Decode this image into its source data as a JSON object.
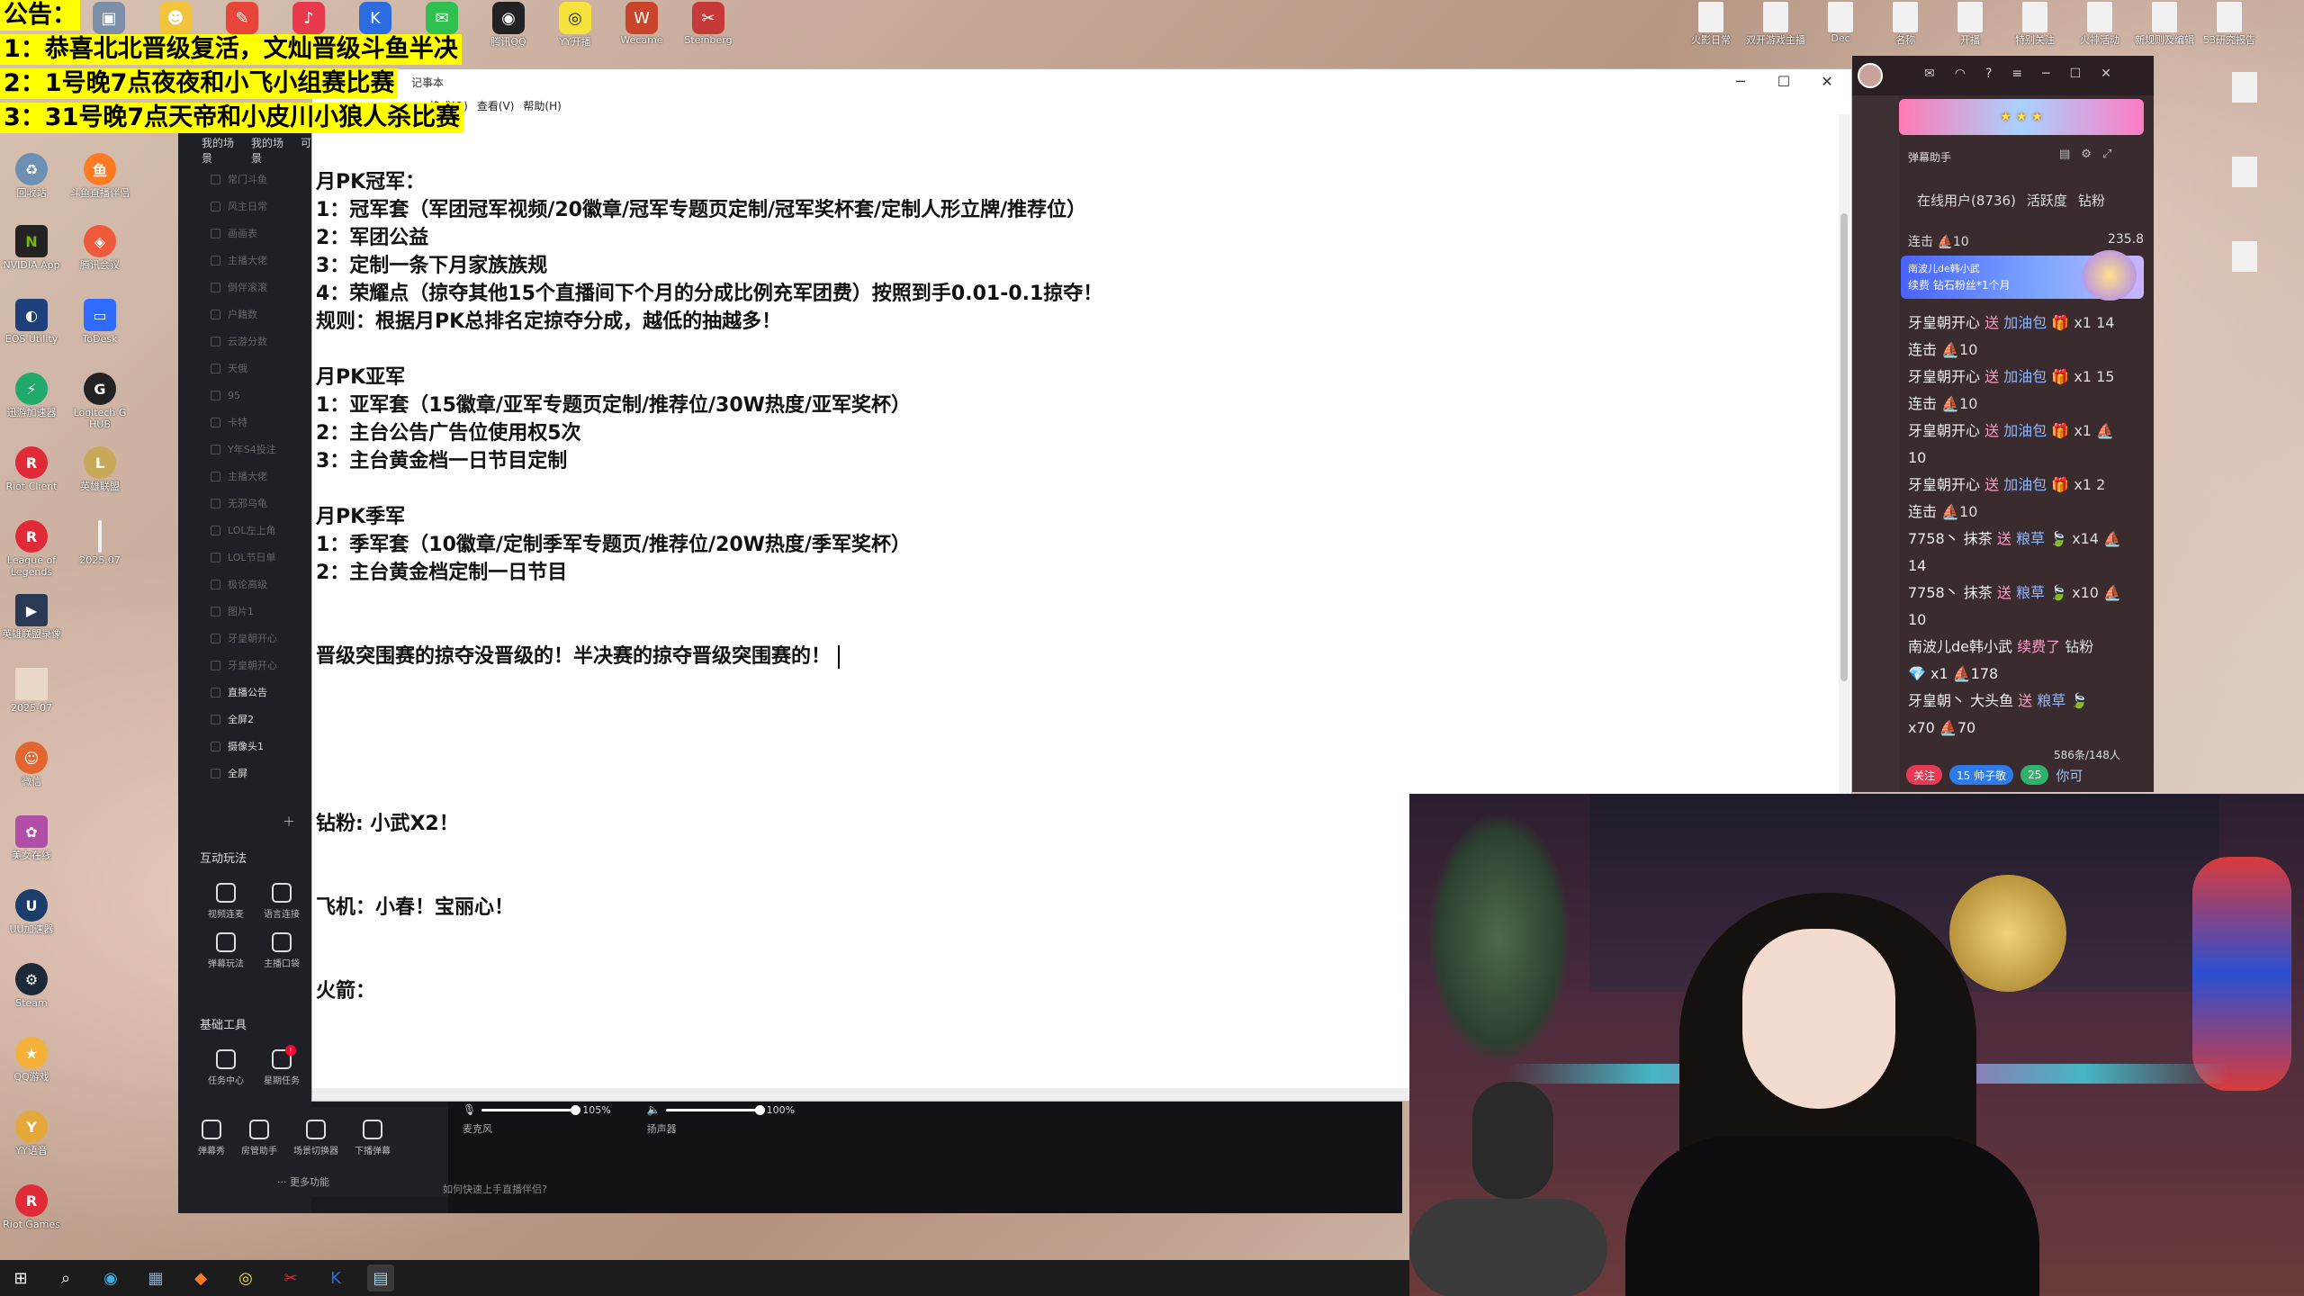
{
  "announcement": {
    "title": "公告：",
    "lines": [
      "1：恭喜北北晋级复活，文灿晋级斗鱼半决",
      "2：1号晚7点夜夜和小飞小组赛比赛",
      "3：31号晚7点天帝和小皮川小狼人杀比赛"
    ]
  },
  "top_icons": [
    "腾讯QQ",
    "YY开播",
    "Wecame",
    "Steinberg"
  ],
  "top_right_icons": [
    "火影日常",
    "双开游戏主播",
    "Dec",
    "名称",
    "开播",
    "特别关注",
    "火神活动",
    "新规则及编辑",
    "53研究报告"
  ],
  "desktop_icons": [
    {
      "label": "回收站"
    },
    {
      "label": "斗鱼直播伴侣"
    },
    {
      "label": "NVIDIA App"
    },
    {
      "label": "腾讯会议"
    },
    {
      "label": "EOS Utility"
    },
    {
      "label": "ToDesk"
    },
    {
      "label": "迅游加速器"
    },
    {
      "label": "Logitech G HUB"
    },
    {
      "label": "Riot Client"
    },
    {
      "label": "英雄联盟"
    },
    {
      "label": "League of Legends"
    },
    {
      "label": "2025.07"
    },
    {
      "label": "英雄联盟录像"
    },
    {
      "label": "2025-07"
    },
    {
      "label": "微信"
    },
    {
      "label": "美女在线"
    },
    {
      "label": "UU加速器"
    },
    {
      "label": "Steam"
    },
    {
      "label": "QQ游戏"
    },
    {
      "label": "YY语音"
    },
    {
      "label": "Riot Games"
    }
  ],
  "obs": {
    "tabs": [
      "我的场景",
      "我的场景",
      "可"
    ],
    "scenes": [
      "常门斗鱼",
      "风主日常",
      "画画表",
      "主播大佬",
      "倒伴滚滚",
      "户籍数",
      "云游分数",
      "天俄",
      "95",
      "卡特",
      "Y年S4投注",
      "主播大佬",
      "无邪乌龟",
      "LOL左上角",
      "LOL节日单",
      "极论高级",
      "图片1",
      "牙皇朝开心",
      "牙皇朝开心",
      "直播公告",
      "全屏2",
      "摄像头1",
      "全屏"
    ],
    "interactive_title": "互动玩法",
    "interactive_tools": [
      "视频连麦",
      "语言连接",
      "弹幕玩法",
      "主播口袋"
    ],
    "basic_title": "基础工具",
    "basic_tools": [
      "任务中心",
      "星期任务",
      "弹幕秀",
      "房管助手",
      "场景切换器",
      "下播弹幕"
    ],
    "more_label": "··· 更多功能",
    "mic_value": "105%",
    "mic_label": "麦克风",
    "speaker_value": "100%",
    "speaker_label": "扬声器",
    "hint": "如何快速上手直播伴侣?"
  },
  "notepad": {
    "title": "记事本",
    "menu": [
      "格式(O)",
      "查看(V)",
      "帮助(H)"
    ],
    "lines": {
      "champion_title": "月PK冠军：",
      "champion_1": "1：冠军套（军团冠军视频/20徽章/冠军专题页定制/冠军奖杯套/定制人形立牌/推荐位）",
      "champion_2": "2：军团公益",
      "champion_3": "3：定制一条下月家族族规",
      "champion_4": "4：荣耀点（掠夺其他15个直播间下个月的分成比例充军团费）按照到手0.01-0.1掠夺！",
      "rule": "规则：根据月PK总排名定掠夺分成，越低的抽越多！",
      "runner_title": "月PK亚军",
      "runner_1": "1：亚军套（15徽章/亚军专题页定制/推荐位/30W热度/亚军奖杯）",
      "runner_2": "2：主台公告广告位使用权5次",
      "runner_3": "3：主台黄金档一日节目定制",
      "third_title": "月PK季军",
      "third_1": "1：季军套（10徽章/定制季军专题页/推荐位/20W热度/季军奖杯）",
      "third_2": "2：主台黄金档定制一日节目",
      "promo": "晋级突围赛的掠夺没晋级的！半决赛的掠夺晋级突围赛的！",
      "diamond": "钻粉: 小武X2！",
      "plane": "飞机：小春！宝丽心！",
      "rocket": "火箭："
    }
  },
  "chat": {
    "assistant_title": "弹幕助手",
    "tabs": [
      "在线用户(8736)",
      "活跃度",
      "钻粉"
    ],
    "combo_label": "连击 ⛵10",
    "combo_value": "235.8",
    "gift_banner_line1": "南波儿de韩小武",
    "gift_banner_line2": "续费 钻石粉丝*1个月",
    "messages": [
      {
        "name": "牙皇朝开心",
        "act": "送",
        "gift": "加油包",
        "sub": "🎁 x1 14"
      },
      {
        "name": "连击",
        "act": "",
        "gift": "",
        "sub": "⛵10"
      },
      {
        "name": "牙皇朝开心",
        "act": "送",
        "gift": "加油包",
        "sub": "🎁 x1 15"
      },
      {
        "name": "连击",
        "act": "",
        "gift": "",
        "sub": "⛵10"
      },
      {
        "name": "牙皇朝开心",
        "act": "送",
        "gift": "加油包",
        "sub": "🎁 x1 ⛵"
      },
      {
        "name": "10",
        "act": "",
        "gift": "",
        "sub": ""
      },
      {
        "name": "牙皇朝开心",
        "act": "送",
        "gift": "加油包",
        "sub": "🎁 x1 2"
      },
      {
        "name": "连击",
        "act": "",
        "gift": "",
        "sub": "⛵10"
      },
      {
        "name": "7758丶 抹茶",
        "act": "送",
        "gift": "粮草",
        "sub": "🍃 x14 ⛵"
      },
      {
        "name": "14",
        "act": "",
        "gift": "",
        "sub": ""
      },
      {
        "name": "7758丶 抹茶",
        "act": "送",
        "gift": "粮草",
        "sub": "🍃 x10 ⛵"
      },
      {
        "name": "10",
        "act": "",
        "gift": "",
        "sub": ""
      },
      {
        "name": "南波儿de韩小武",
        "act": "续费了",
        "gift": "",
        "sub": "钻粉"
      },
      {
        "name": "💎 x1 ⛵178",
        "act": "",
        "gift": "",
        "sub": ""
      },
      {
        "name": "牙皇朝丶 大头鱼",
        "act": "送",
        "gift": "粮草",
        "sub": "🍃"
      },
      {
        "name": "x70 ⛵70",
        "act": "",
        "gift": "",
        "sub": ""
      }
    ],
    "count": "586条/148人",
    "follow": "关注",
    "fans_badge": "15 帅子敬",
    "level_badge": "25",
    "input_hint": "你可"
  },
  "taskbar": [
    "windows-start",
    "search",
    "edge",
    "explorer",
    "app",
    "yy",
    "riot",
    "kugou",
    "notepad"
  ]
}
